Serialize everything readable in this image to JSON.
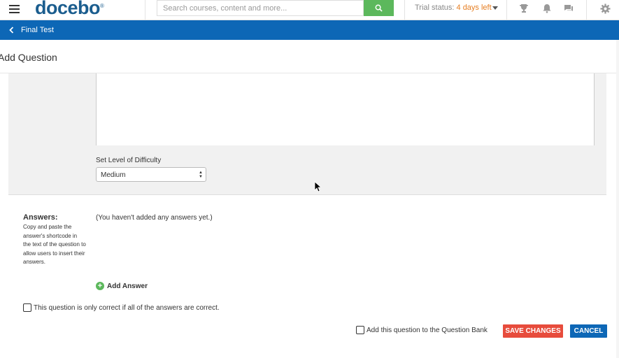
{
  "header": {
    "logo": "docebo",
    "logo_mark": "®",
    "search_placeholder": "Search courses, content and more...",
    "trial_label": "Trial status:",
    "trial_days": "4 days left"
  },
  "breadcrumb": {
    "back_label": "Final Test"
  },
  "page": {
    "title": "Add Question"
  },
  "difficulty": {
    "label": "Set Level of Difficulty",
    "selected": "Medium"
  },
  "answers": {
    "heading": "Answers:",
    "help": "Copy and paste the answer's shortcode in the text of the question to allow users to insert their answers.",
    "empty_text": "(You haven't added any answers yet.)",
    "add_label": "Add Answer"
  },
  "options": {
    "all_correct_label": "This question is only correct if all of the answers are correct.",
    "bank_label": "Add this question to the Question Bank"
  },
  "actions": {
    "save_label": "SAVE CHANGES",
    "cancel_label": "CANCEL"
  },
  "colors": {
    "brand_blue": "#0d67b6",
    "logo_blue": "#1b5d8e",
    "search_green": "#5cb85c",
    "save_red": "#e74c3c",
    "trial_orange": "#e67e22"
  }
}
